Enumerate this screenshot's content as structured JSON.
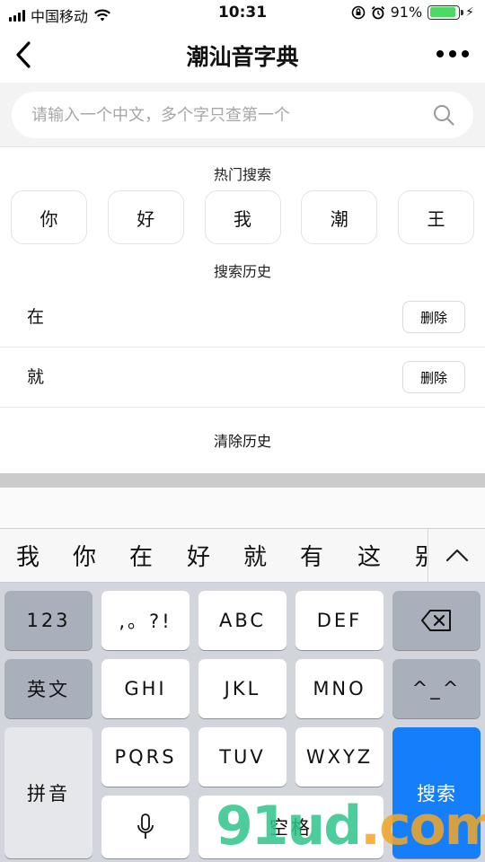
{
  "status_bar": {
    "carrier": "中国移动",
    "time": "10:31",
    "battery_pct": "91%",
    "battery_level": 0.91
  },
  "nav": {
    "title": "潮汕音字典"
  },
  "search": {
    "placeholder": "请输入一个中文，多个字只查第一个",
    "value": ""
  },
  "hot": {
    "title": "热门搜索",
    "items": [
      "你",
      "好",
      "我",
      "潮",
      "王"
    ]
  },
  "history": {
    "title": "搜索历史",
    "items": [
      {
        "char": "在",
        "delete_label": "删除"
      },
      {
        "char": "就",
        "delete_label": "删除"
      }
    ],
    "clear_label": "清除历史"
  },
  "keyboard": {
    "candidates": [
      "我",
      "你",
      "在",
      "好",
      "就",
      "有",
      "这",
      "别"
    ],
    "keys": {
      "num": "123",
      "punct": ",。?!",
      "abc": "ABC",
      "def": "DEF",
      "english": "英文",
      "ghi": "GHI",
      "jkl": "JKL",
      "mno": "MNO",
      "emoticon": "^_^",
      "pinyin": "拼音",
      "pqrs": "PQRS",
      "tuv": "TUV",
      "wxyz": "WXYZ",
      "search": "搜索",
      "space": "空格"
    }
  },
  "watermark": {
    "main": "91ud",
    "suffix": ".com"
  },
  "colors": {
    "accent": "#147efb",
    "battery": "#4cd964",
    "keyboard_bg": "#d2d5db"
  }
}
